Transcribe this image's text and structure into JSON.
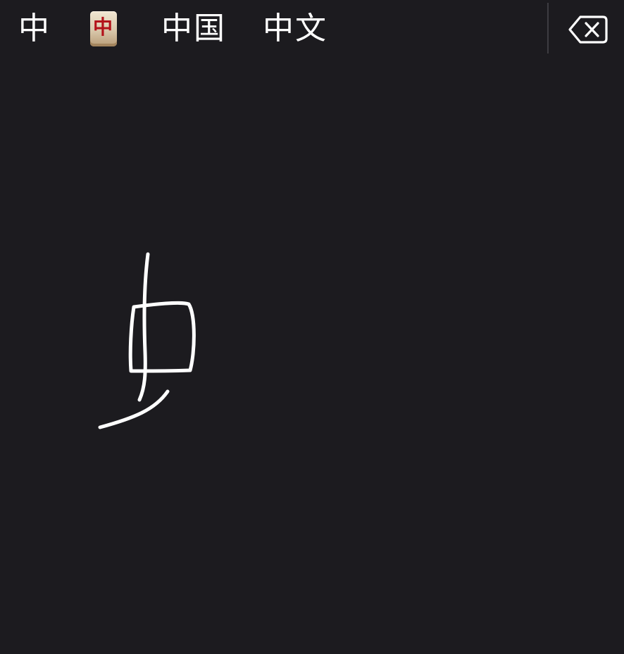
{
  "candidates": [
    {
      "label": "中"
    },
    {
      "label": "中",
      "type": "mahjong-tile-emoji"
    },
    {
      "label": "中国"
    },
    {
      "label": "中文"
    }
  ],
  "delete_key": {
    "icon": "delete-backspace-icon"
  },
  "handwriting": {
    "ink_color": "#ffffff"
  },
  "colors": {
    "background": "#1c1b1f",
    "divider": "#3d3c41",
    "text": "#ffffff",
    "tile_glyph": "#b3121a"
  }
}
